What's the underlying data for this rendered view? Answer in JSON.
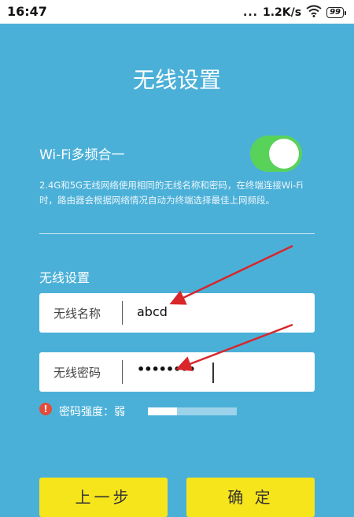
{
  "status": {
    "time": "16:47",
    "signal_dots": "...",
    "speed": "1.2K/s",
    "battery": "99"
  },
  "page_title": "无线设置",
  "wifi_merge": {
    "label": "Wi-Fi多频合一",
    "enabled": true,
    "description": "2.4G和5G无线网络使用相同的无线名称和密码，在终端连接Wi-Fi时，路由器会根据网络情况自动为终端选择最佳上网频段。"
  },
  "section_title": "无线设置",
  "ssid": {
    "label": "无线名称",
    "value": "abcd"
  },
  "password": {
    "label": "无线密码",
    "value": "••••••••"
  },
  "strength": {
    "icon": "!",
    "label": "密码强度：弱",
    "level": 0.33
  },
  "buttons": {
    "prev": "上一步",
    "ok": "确 定"
  },
  "colors": {
    "background": "#4bb0d8",
    "toggle_on": "#59d25a",
    "button": "#f7e51c",
    "annotation_arrow": "#d8262b"
  },
  "icons": [
    "wifi-icon",
    "battery-icon",
    "warning-icon",
    "annotation-arrow"
  ]
}
